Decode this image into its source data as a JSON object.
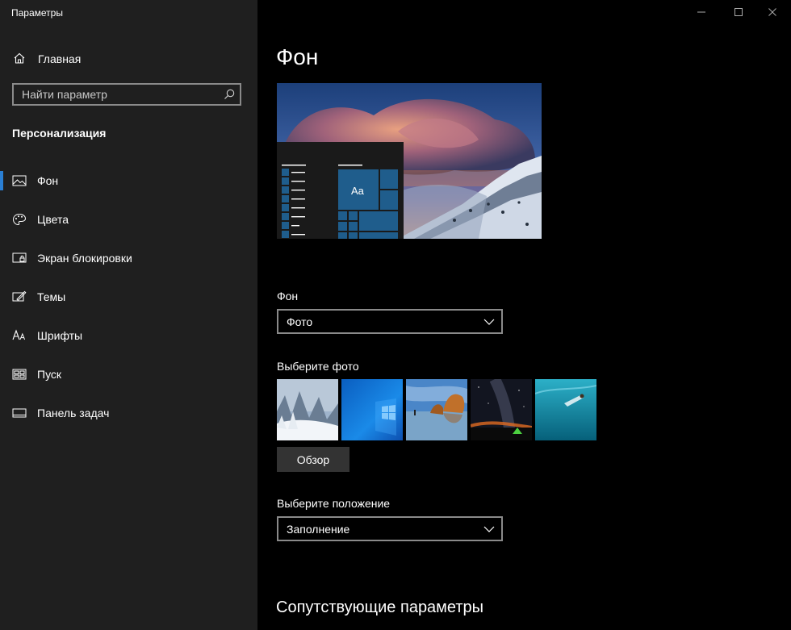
{
  "window": {
    "title": "Параметры",
    "controls": {
      "minimize": "minimize-icon",
      "maximize": "maximize-icon",
      "close": "close-icon"
    }
  },
  "sidebar": {
    "home_label": "Главная",
    "search_placeholder": "Найти параметр",
    "section_title": "Персонализация",
    "items": [
      {
        "label": "Фон",
        "icon": "picture-icon",
        "active": true
      },
      {
        "label": "Цвета",
        "icon": "palette-icon",
        "active": false
      },
      {
        "label": "Экран блокировки",
        "icon": "lock-screen-icon",
        "active": false
      },
      {
        "label": "Темы",
        "icon": "themes-icon",
        "active": false
      },
      {
        "label": "Шрифты",
        "icon": "fonts-icon",
        "active": false
      },
      {
        "label": "Пуск",
        "icon": "start-icon",
        "active": false
      },
      {
        "label": "Панель задач",
        "icon": "taskbar-icon",
        "active": false
      }
    ]
  },
  "main": {
    "title": "Фон",
    "preview_tile_label": "Aa",
    "background_label": "Фон",
    "background_value": "Фото",
    "choose_photo_label": "Выберите фото",
    "browse_label": "Обзор",
    "position_label": "Выберите положение",
    "position_value": "Заполнение",
    "related_title": "Сопутствующие параметры"
  },
  "colors": {
    "accent": "#2a7fd4",
    "sidebar_bg": "#1f1f1f",
    "content_bg": "#000000",
    "tile_blue": "#1f5d8c"
  }
}
